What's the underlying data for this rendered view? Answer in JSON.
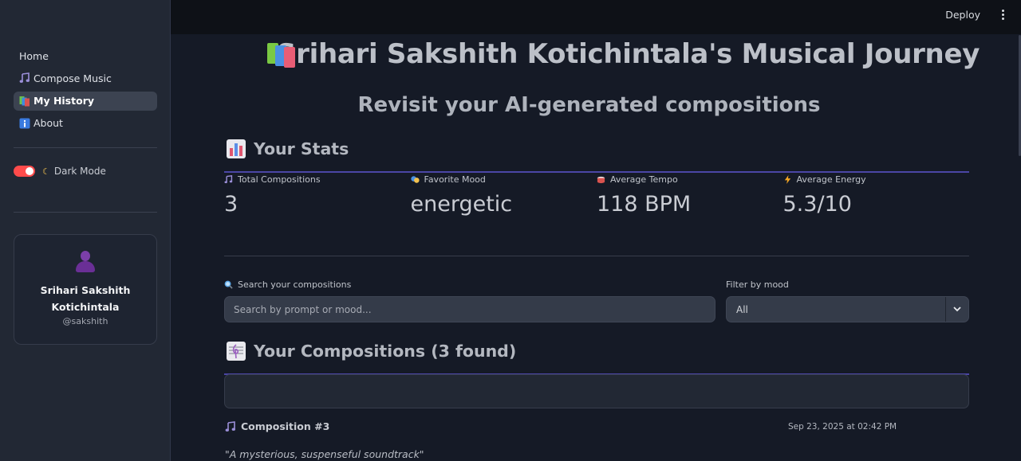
{
  "topbar": {
    "deploy_label": "Deploy",
    "menu_icon": "kebab-menu-icon"
  },
  "sidebar": {
    "items": [
      {
        "label": "Home",
        "icon": "",
        "active": false
      },
      {
        "label": "Compose Music",
        "icon": "music-note-icon",
        "active": false
      },
      {
        "label": "My History",
        "icon": "books-icon",
        "active": true
      },
      {
        "label": "About",
        "icon": "info-icon",
        "active": false
      }
    ],
    "dark_mode": {
      "label": "Dark Mode",
      "enabled": true,
      "icon": "moon-icon"
    },
    "profile": {
      "name": "Srihari Sakshith Kotichintala",
      "handle": "@sakshith",
      "avatar_icon": "person-silhouette-icon"
    }
  },
  "main": {
    "title": "Srihari Sakshith Kotichintala's Musical Journey",
    "subtitle": "Revisit your AI-generated compositions",
    "stats_heading": "Your Stats",
    "stats": [
      {
        "label": "Total Compositions",
        "value": "3",
        "icon": "music-note-icon"
      },
      {
        "label": "Favorite Mood",
        "value": "energetic",
        "icon": "theater-masks-icon"
      },
      {
        "label": "Average Tempo",
        "value": "118 BPM",
        "icon": "drum-icon"
      },
      {
        "label": "Average Energy",
        "value": "5.3/10",
        "icon": "lightning-icon"
      }
    ],
    "search": {
      "label": "Search your compositions",
      "placeholder": "Search by prompt or mood...",
      "value": ""
    },
    "filter": {
      "label": "Filter by mood",
      "selected": "All"
    },
    "compositions_heading": "Your Compositions (3 found)",
    "composition": {
      "title": "Composition #3",
      "date": "Sep 23, 2025 at 02:42 PM",
      "prompt": "\"A mysterious, suspenseful soundtrack\""
    }
  },
  "colors": {
    "accent_red": "#ff4b4b",
    "rule_purple": "#4b46a6",
    "background": "#151a26"
  }
}
